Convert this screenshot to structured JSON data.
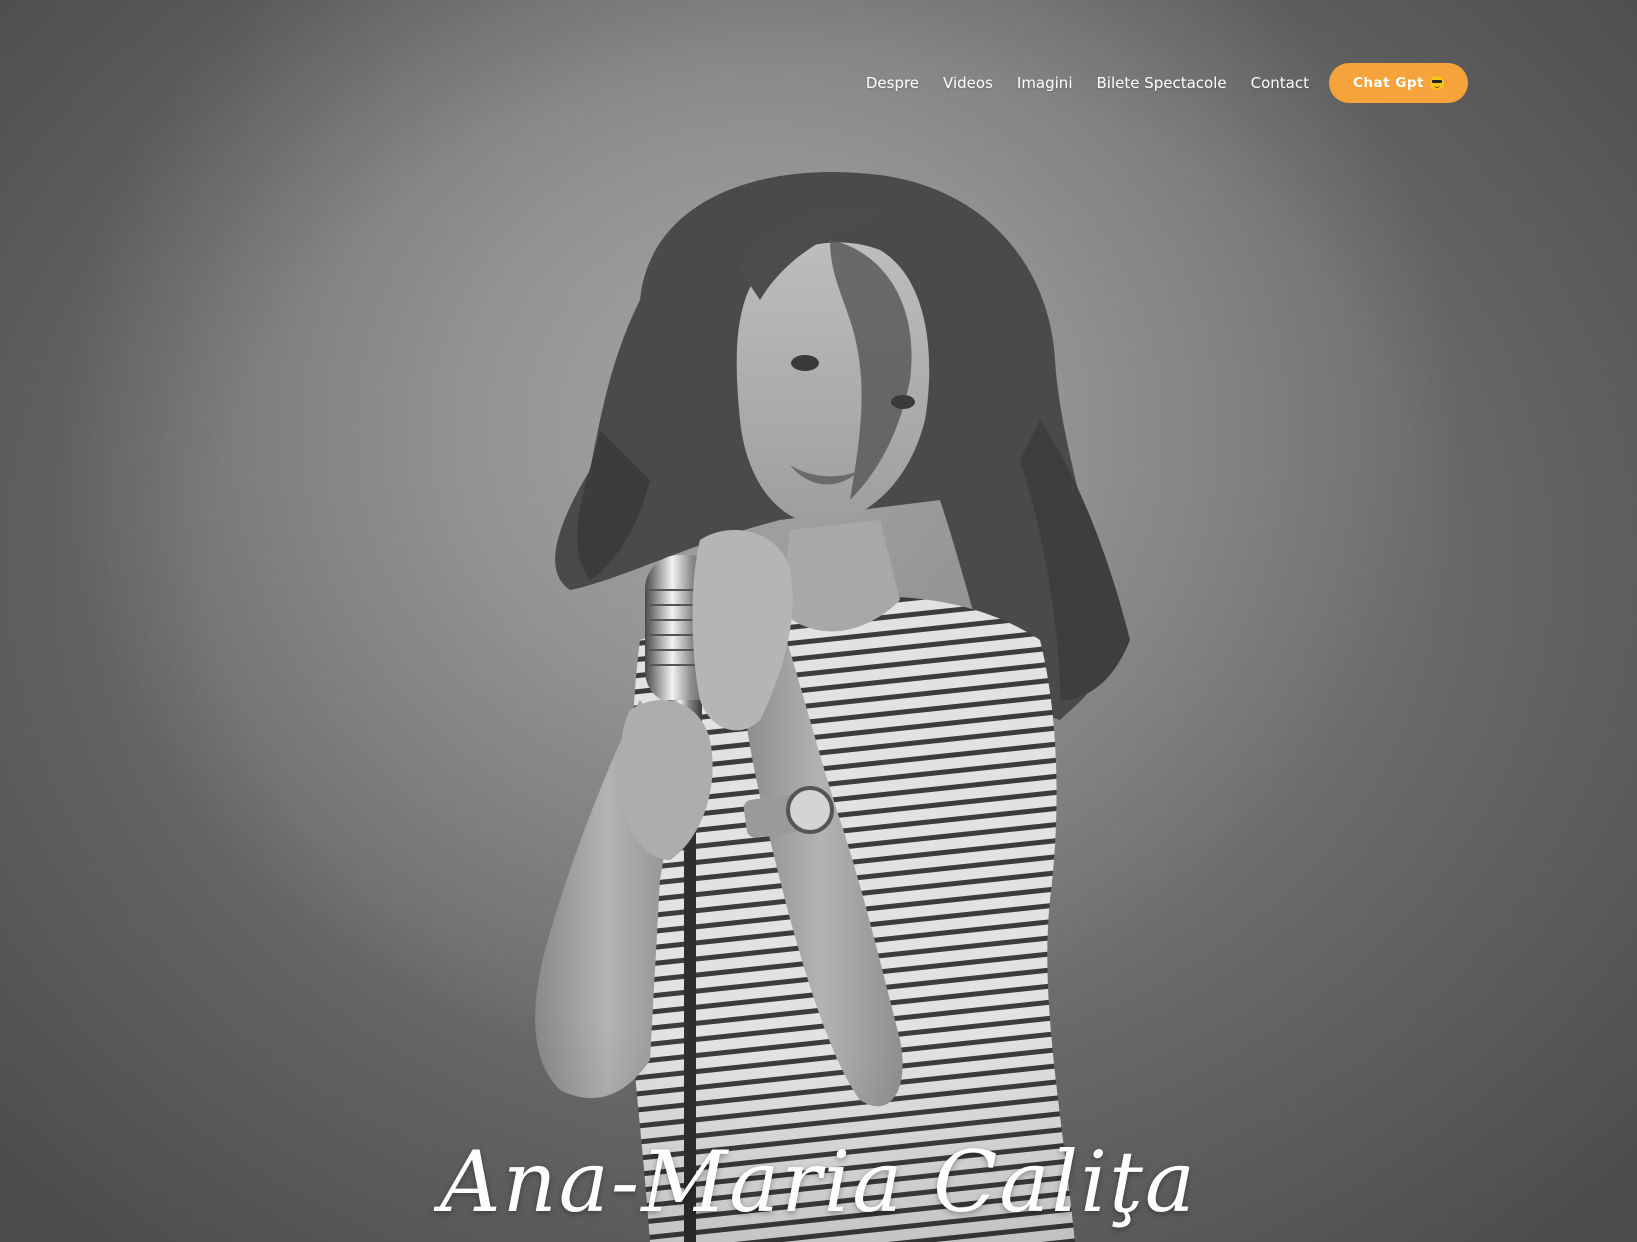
{
  "nav": {
    "items": [
      {
        "label": "Despre"
      },
      {
        "label": "Videos"
      },
      {
        "label": "Imagini"
      },
      {
        "label": "Bilete Spectacole"
      },
      {
        "label": "Contact"
      }
    ],
    "cta": {
      "label": "Chat Gpt",
      "icon": "sunglasses-emoji-icon",
      "color": "#f7a33c"
    }
  },
  "hero": {
    "signature": "Ana-Maria Caliţa",
    "image": "black-and-white photo of a curly-haired woman in a striped t-shirt holding a vintage microphone"
  }
}
